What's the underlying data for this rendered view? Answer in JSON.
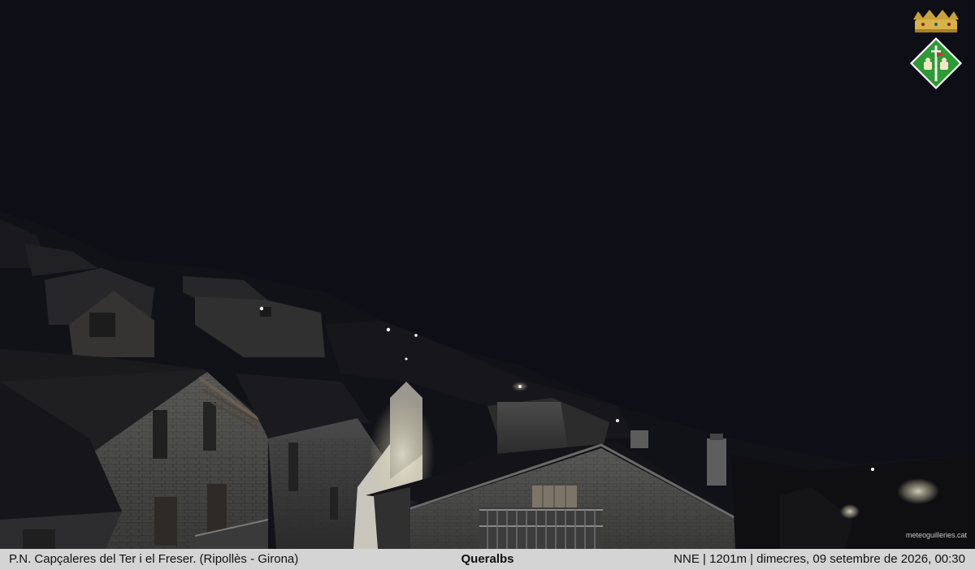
{
  "caption": {
    "left": "P.N. Capçaleres del Ter i el Freser. (Ripollès - Girona)",
    "center": "Queralbs",
    "right": "NNE | 1201m | dimecres, 09 setembre de 2026, 00:30"
  },
  "watermark": "meteoguilleries.cat",
  "icons": {
    "crest": "coat-of-arms-icon"
  },
  "colors": {
    "sky": "#0e0e16",
    "caption_bar": "#d4d4d4",
    "crest_green": "#2e9a35"
  }
}
